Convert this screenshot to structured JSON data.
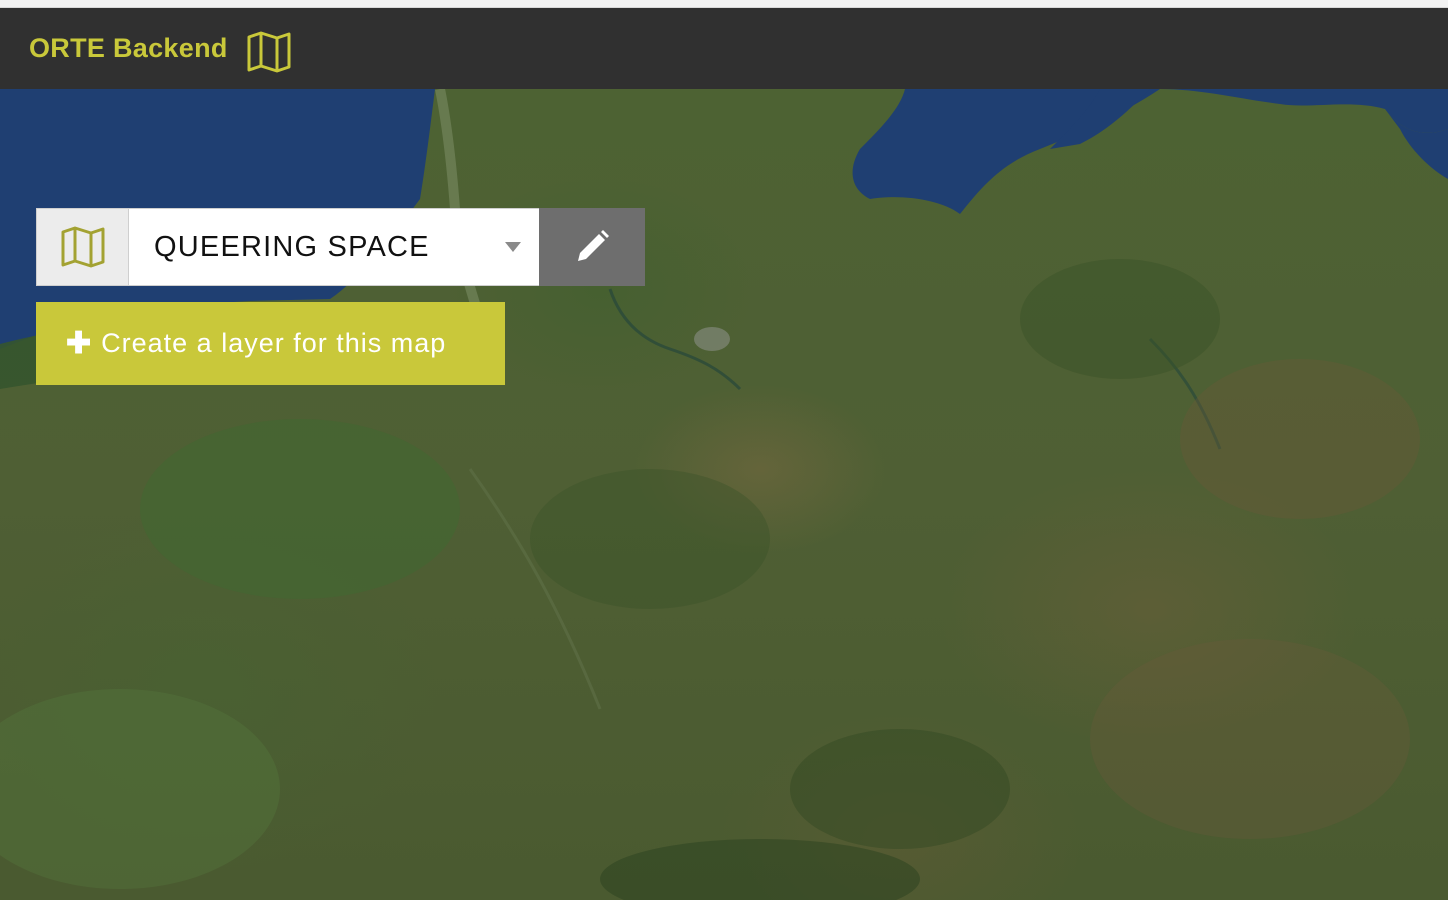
{
  "app": {
    "title": "ORTE Backend",
    "brand_icon": "map-icon",
    "accent_color": "#c9c83a",
    "header_color": "#303030"
  },
  "map_selector": {
    "icon": "map-icon",
    "selected_map": "QUEERING SPACE",
    "edit_icon": "pencil-icon"
  },
  "create_layer": {
    "icon": "plus-icon",
    "label": "Create a layer for this map"
  }
}
